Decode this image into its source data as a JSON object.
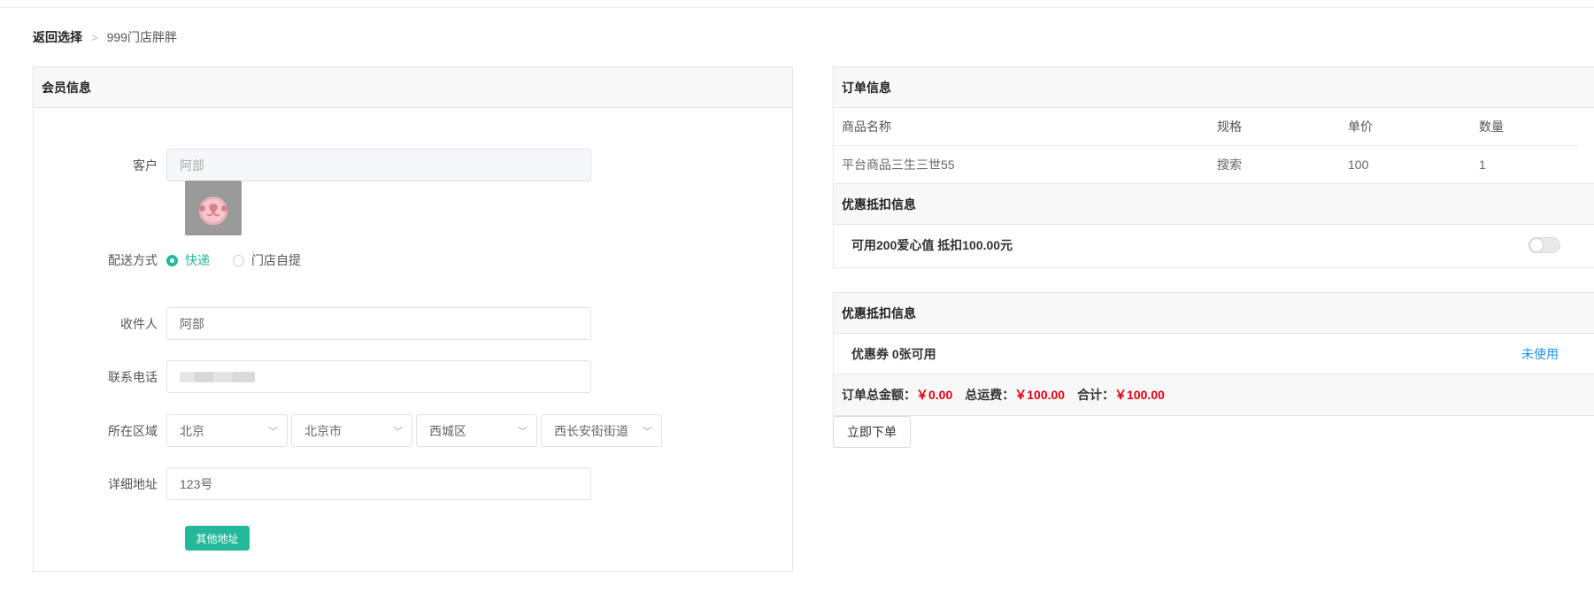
{
  "breadcrumb": {
    "back": "返回选择",
    "separator": ">",
    "current": "999门店胖胖"
  },
  "member": {
    "title": "会员信息",
    "customer_label": "客户",
    "customer_placeholder": "阿部",
    "delivery_label": "配送方式",
    "delivery_options": [
      {
        "label": "快递",
        "selected": true
      },
      {
        "label": "门店自提",
        "selected": false
      }
    ],
    "receiver_label": "收件人",
    "receiver_value": "阿部",
    "phone_label": "联系电话",
    "region_label": "所在区域",
    "region": [
      "北京",
      "北京市",
      "西城区",
      "西长安街街道"
    ],
    "address_label": "详细地址",
    "address_value": "123号",
    "other_address_button": "其他地址"
  },
  "order": {
    "title": "订单信息",
    "columns": [
      "商品名称",
      "规格",
      "单价",
      "数量"
    ],
    "rows": [
      [
        "平台商品三生三世55",
        "搜索",
        "100",
        "1"
      ]
    ],
    "discount_title": "优惠抵扣信息",
    "discount_text": "可用200爱心值 抵扣100.00元",
    "discount_enabled": false
  },
  "coupon": {
    "title": "优惠抵扣信息",
    "coupon_text": "优惠券 0张可用",
    "coupon_action": "未使用",
    "total_label": "订单总金额：",
    "total_value": "￥0.00",
    "shipping_label": "总运费：",
    "shipping_value": "￥100.00",
    "sum_label": "合计：",
    "sum_value": "￥100.00"
  },
  "submit_button": "立即下单",
  "colors": {
    "accent": "#26b89a",
    "price": "#e60012",
    "link": "#1e90ff"
  }
}
